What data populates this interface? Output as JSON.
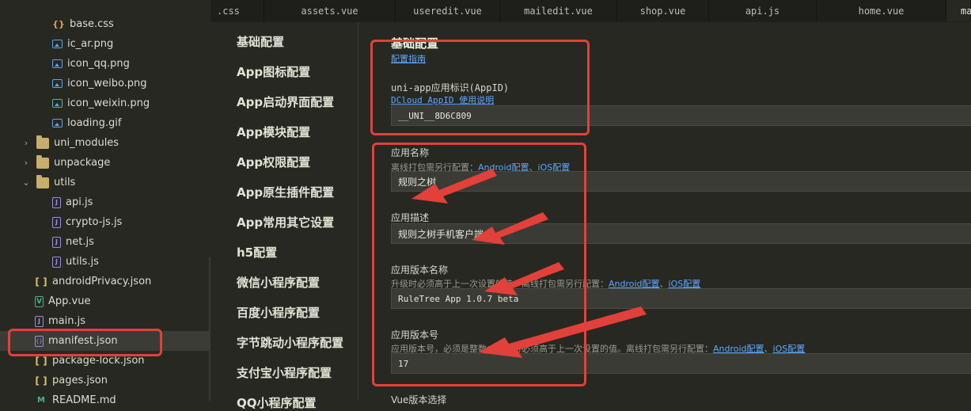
{
  "tree": {
    "items": [
      {
        "label": "base.css",
        "icon": "css-braces-icon"
      },
      {
        "label": "ic_ar.png",
        "icon": "image-icon"
      },
      {
        "label": "icon_qq.png",
        "icon": "image-icon"
      },
      {
        "label": "icon_weibo.png",
        "icon": "image-icon"
      },
      {
        "label": "icon_weixin.png",
        "icon": "image-icon"
      },
      {
        "label": "loading.gif",
        "icon": "image-icon"
      },
      {
        "label": "uni_modules",
        "icon": "folder-icon"
      },
      {
        "label": "unpackage",
        "icon": "folder-icon"
      },
      {
        "label": "utils",
        "icon": "folder-open-icon"
      },
      {
        "label": "api.js",
        "icon": "js-file-icon"
      },
      {
        "label": "crypto-js.js",
        "icon": "js-file-icon"
      },
      {
        "label": "net.js",
        "icon": "js-file-icon"
      },
      {
        "label": "utils.js",
        "icon": "js-file-icon"
      },
      {
        "label": "androidPrivacy.json",
        "icon": "json-bracket-icon"
      },
      {
        "label": "App.vue",
        "icon": "vue-file-icon"
      },
      {
        "label": "main.js",
        "icon": "js-file-icon"
      },
      {
        "label": "manifest.json",
        "icon": "manifest-icon"
      },
      {
        "label": "package-lock.json",
        "icon": "json-bracket-icon"
      },
      {
        "label": "pages.json",
        "icon": "json-bracket-icon"
      },
      {
        "label": "README.md",
        "icon": "markdown-icon"
      }
    ]
  },
  "tabs": [
    {
      "label": ".css"
    },
    {
      "label": "assets.vue"
    },
    {
      "label": "useredit.vue"
    },
    {
      "label": "mailedit.vue"
    },
    {
      "label": "shop.vue"
    },
    {
      "label": "api.js"
    },
    {
      "label": "home.vue"
    },
    {
      "label": "ma"
    }
  ],
  "confnav": {
    "items": [
      {
        "label": "基础配置"
      },
      {
        "label": "App图标配置"
      },
      {
        "label": "App启动界面配置"
      },
      {
        "label": "App模块配置"
      },
      {
        "label": "App权限配置"
      },
      {
        "label": "App原生插件配置"
      },
      {
        "label": "App常用其它设置"
      },
      {
        "label": "h5配置"
      },
      {
        "label": "微信小程序配置"
      },
      {
        "label": "百度小程序配置"
      },
      {
        "label": "字节跳动小程序配置"
      },
      {
        "label": "支付宝小程序配置"
      },
      {
        "label": "QQ小程序配置"
      }
    ]
  },
  "form": {
    "title": "基础配置",
    "guide_link": "配置指南",
    "appid": {
      "label": "uni-app应用标识(AppID)",
      "help_link": "DCloud AppID 使用说明",
      "value": "__UNI__8D6C809"
    },
    "name": {
      "label": "应用名称",
      "hint": "离线打包需另行配置：",
      "android_link": "Android配置",
      "sep": "、",
      "ios_link": "iOS配置",
      "value": "规则之树"
    },
    "desc": {
      "label": "应用描述",
      "value": "规则之树手机客户端"
    },
    "version_name": {
      "label": "应用版本名称",
      "hint": "升级时必须高于上一次设置的值。离线打包需另行配置：",
      "android_link": "Android配置",
      "sep": "、",
      "ios_link": "iOS配置",
      "value": "RuleTree App 1.0.7 beta"
    },
    "version_code": {
      "label": "应用版本号",
      "hint": "应用版本号，必须是整数；升级时必须高于上一次设置的值。离线打包需另行配置：",
      "android_link": "Android配置",
      "sep": "、",
      "ios_link": "iOS配置",
      "value": "17"
    },
    "vue_version_label": "Vue版本选择"
  },
  "colors": {
    "annotation_red": "#e2403a",
    "link_blue": "#5ea9ff",
    "background": "#272822"
  }
}
